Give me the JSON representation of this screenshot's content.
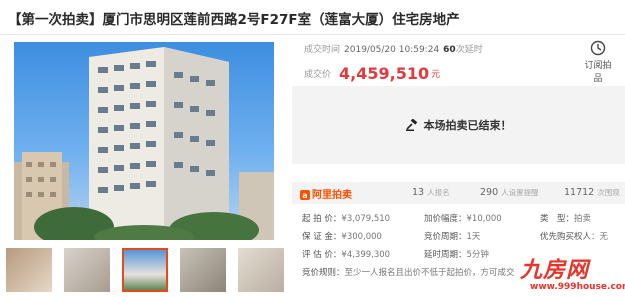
{
  "title": "【第一次拍卖】厦门市思明区莲前西路2号F27F室（莲富大厦）住宅房地产",
  "deal_time_label": "成交时间",
  "deal_time": "2019/05/20 10:59:24",
  "bid_count": "60",
  "bid_count_suffix": "次延时",
  "price_label": "成交价",
  "price": "4,459,510",
  "price_unit": "元",
  "remind_label": "订阅拍品",
  "ended_text": "本场拍卖已结束！",
  "platform": "阿里拍卖",
  "stats": [
    {
      "value": "13",
      "label": "人报名"
    },
    {
      "value": "290",
      "label": "人设置提醒"
    },
    {
      "value": "11712",
      "label": "次围观"
    }
  ],
  "details": {
    "start_price_label": "起 拍 价：",
    "start_price": "¥3,079,510",
    "increment_label": "加价幅度：",
    "increment": "¥10,000",
    "type_label": "类　型：",
    "type": "拍卖",
    "deposit_label": "保 证 金：",
    "deposit": "¥300,000",
    "period_label": "竞价周期：",
    "period": "1天",
    "priority_label": "优先购买权人",
    "priority": "：无",
    "eval_label": "评 估 价：",
    "eval": "¥4,399,300",
    "delay_label": "延时周期：",
    "delay": "5分钟",
    "rule_label": "竞价规则：",
    "rule": "至少一人报名且出价不低于起拍价，方可成交"
  },
  "watermark": {
    "text": "九房网",
    "url": "www.999house.com"
  },
  "colors": {
    "price": "#e4393c",
    "platform": "#ff5000",
    "watermark": "#e8332a"
  }
}
